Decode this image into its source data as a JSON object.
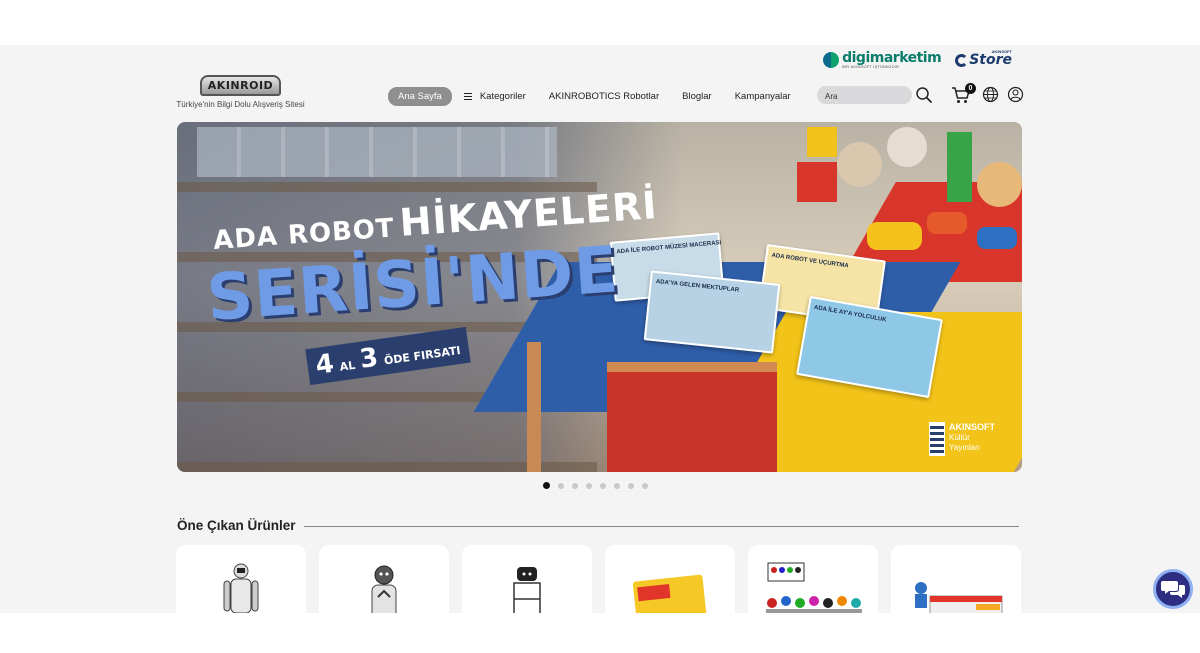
{
  "partners": {
    "digimarketim": "digimarketim",
    "digimarketim_sub": "BİR AKINSOFT İŞTİRAKİDİR",
    "store": "Store",
    "store_sup": "AKINSOFT"
  },
  "brand": {
    "logo_text": "AKINROID",
    "tagline": "Türkiye'nin Bilgi Dolu Alışveriş Sitesi"
  },
  "nav": {
    "home": "Ana Sayfa",
    "categories": "Kategoriler",
    "robots": "AKINROBOTICS Robotlar",
    "blogs": "Bloglar",
    "campaigns": "Kampanyalar"
  },
  "search": {
    "placeholder": "Ara"
  },
  "cart": {
    "count": "0"
  },
  "hero": {
    "line1_a": "ADA ROBOT",
    "line1_b": "HİKAYELERİ",
    "line2": "SERİSİ'NDE",
    "badge_n1": "4",
    "badge_al": "AL",
    "badge_n2": "3",
    "badge_rest": "ÖDE FIRSATI",
    "books": [
      "ADA İLE ROBOT MÜZESİ MACERASI",
      "ADA ROBOT VE UÇURTMA",
      "ADA'YA GELEN MEKTUPLAR",
      "ADA İLE AY'A YOLCULUK"
    ],
    "publisher": {
      "name": "AKINSOFT",
      "line2": "Kültür",
      "line3": "Yayınları"
    }
  },
  "carousel": {
    "count": 8,
    "active": 0
  },
  "section": {
    "title": "Öne Çıkan Ürünler"
  },
  "colors": {
    "page_bg": "#f4f4f5",
    "nav_active": "#8f8f8f",
    "hero_blue": "#6f9be6",
    "chat": "#2d2e82"
  },
  "icons": {
    "search": "search-icon",
    "cart": "cart-icon",
    "globe": "globe-icon",
    "user": "user-icon",
    "chat": "chat-icon"
  }
}
